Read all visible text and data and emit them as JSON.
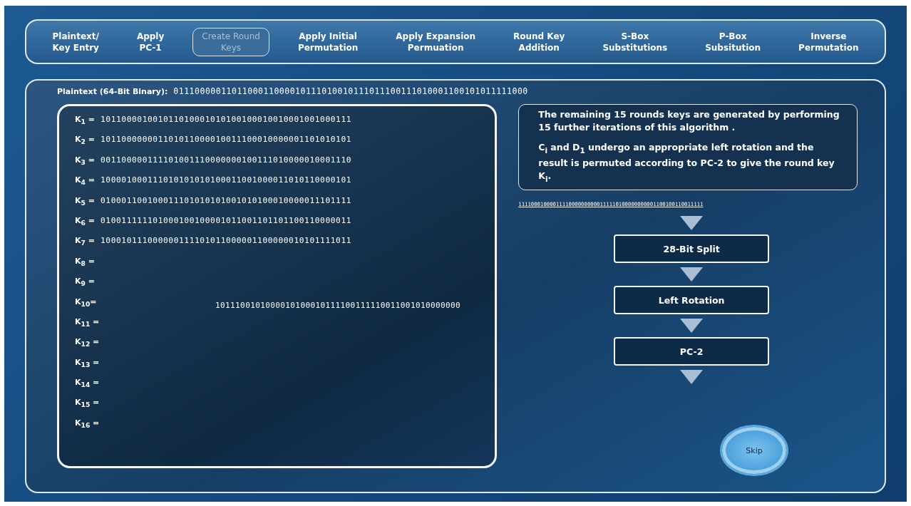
{
  "tabs": [
    {
      "label": "Plaintext/\nKey Entry",
      "selected": false
    },
    {
      "label": "Apply\nPC-1",
      "selected": false
    },
    {
      "label": "Create Round\nKeys",
      "selected": true
    },
    {
      "label": "Apply Initial\nPermutation",
      "selected": false
    },
    {
      "label": "Apply Expansion\nPermuation",
      "selected": false
    },
    {
      "label": "Round Key\nAddition",
      "selected": false
    },
    {
      "label": "S-Box\nSubstitutions",
      "selected": false
    },
    {
      "label": "P-Box\nSubsitution",
      "selected": false
    },
    {
      "label": "Inverse\nPermutation",
      "selected": false
    }
  ],
  "plaintext": {
    "label": "Plaintext (64-Bit Binary):",
    "value": "0111000001101100011000010111010010111011100111010001100101011111000"
  },
  "round_keys": [
    {
      "label": "K$_{1}$ =",
      "value": "101100001001011010001010100100010010001001000111"
    },
    {
      "label": "K$_{2}$ =",
      "value": "101100000001101011000010011100010000001101010101"
    },
    {
      "label": "K$_{3}$ =",
      "value": "001100000111101001110000000100111010000010001110"
    },
    {
      "label": "K$_{4}$ =",
      "value": "100001000111010101010100011001000011010110000101"
    },
    {
      "label": "K$_{5}$ =",
      "value": "010001100100011101010101001010100010000011101111"
    },
    {
      "label": "K$_{6}$ =",
      "value": "010011111101000100100001011001101101100110000011"
    },
    {
      "label": "K$_{7}$ =",
      "value": "100010111000000111101011000001100000010101111011"
    },
    {
      "label": "K$_{8}$ ="
    },
    {
      "label": "K$_{9}$ ="
    },
    {
      "label": "K$_{10}$="
    },
    {
      "label": "K$_{11}$ ="
    },
    {
      "label": "K$_{12}$ ="
    },
    {
      "label": "K$_{13}$ ="
    },
    {
      "label": "K$_{14}$ ="
    },
    {
      "label": "K$_{15}$ ="
    },
    {
      "label": "K$_{16}$ ="
    }
  ],
  "moving_key": "1011100101000010100010111100111110011001010000000",
  "explanation": [
    "The remaining 15 rounds keys are generated by performing 15 further iterations of this algorithm .",
    "C$_{i}$ and D$_{1}$ undergo an appropriate left rotation and the result is permuted according to PC-2 to give the round key K$_{i}$."
  ],
  "input_bits": "11110001000011110000000000111110100000000001100100110011111",
  "steps": [
    "28-Bit Split",
    "Left Rotation",
    "PC-2"
  ],
  "skip_button": "Skip"
}
